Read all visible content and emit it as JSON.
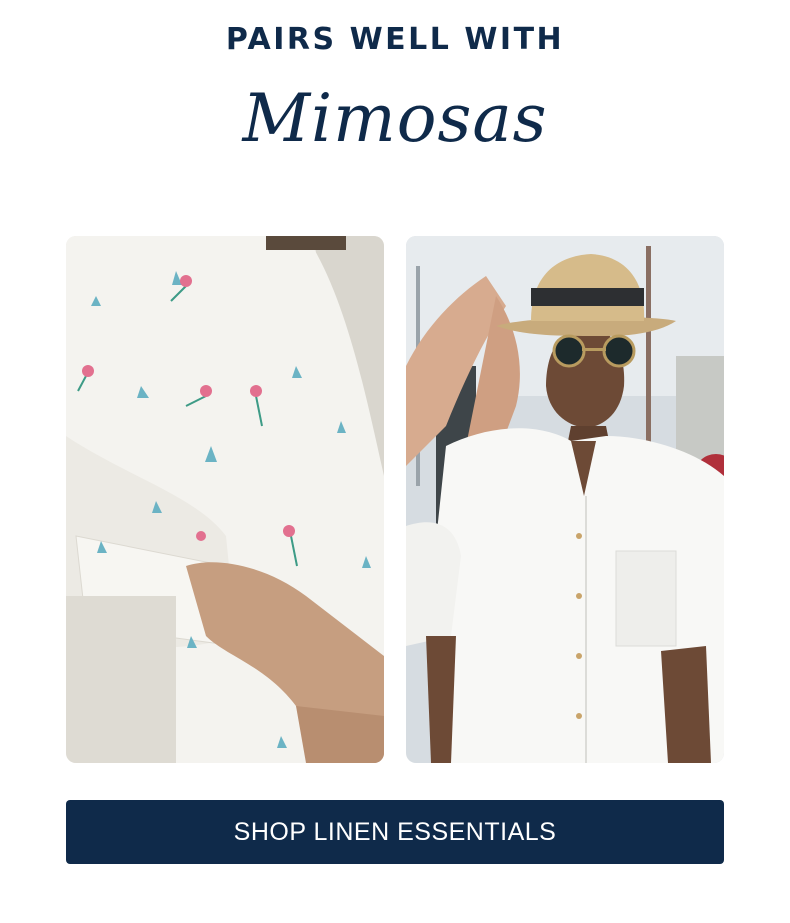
{
  "header": {
    "headline": "PAIRS WELL WITH",
    "script_word": "Mimosas"
  },
  "images": {
    "left": {
      "icon": "shirt-closeup-image"
    },
    "right": {
      "icon": "man-in-hat-image"
    }
  },
  "cta": {
    "label": "SHOP LINEN ESSENTIALS"
  },
  "colors": {
    "navy": "#0f2a4a",
    "background": "#ffffff"
  }
}
